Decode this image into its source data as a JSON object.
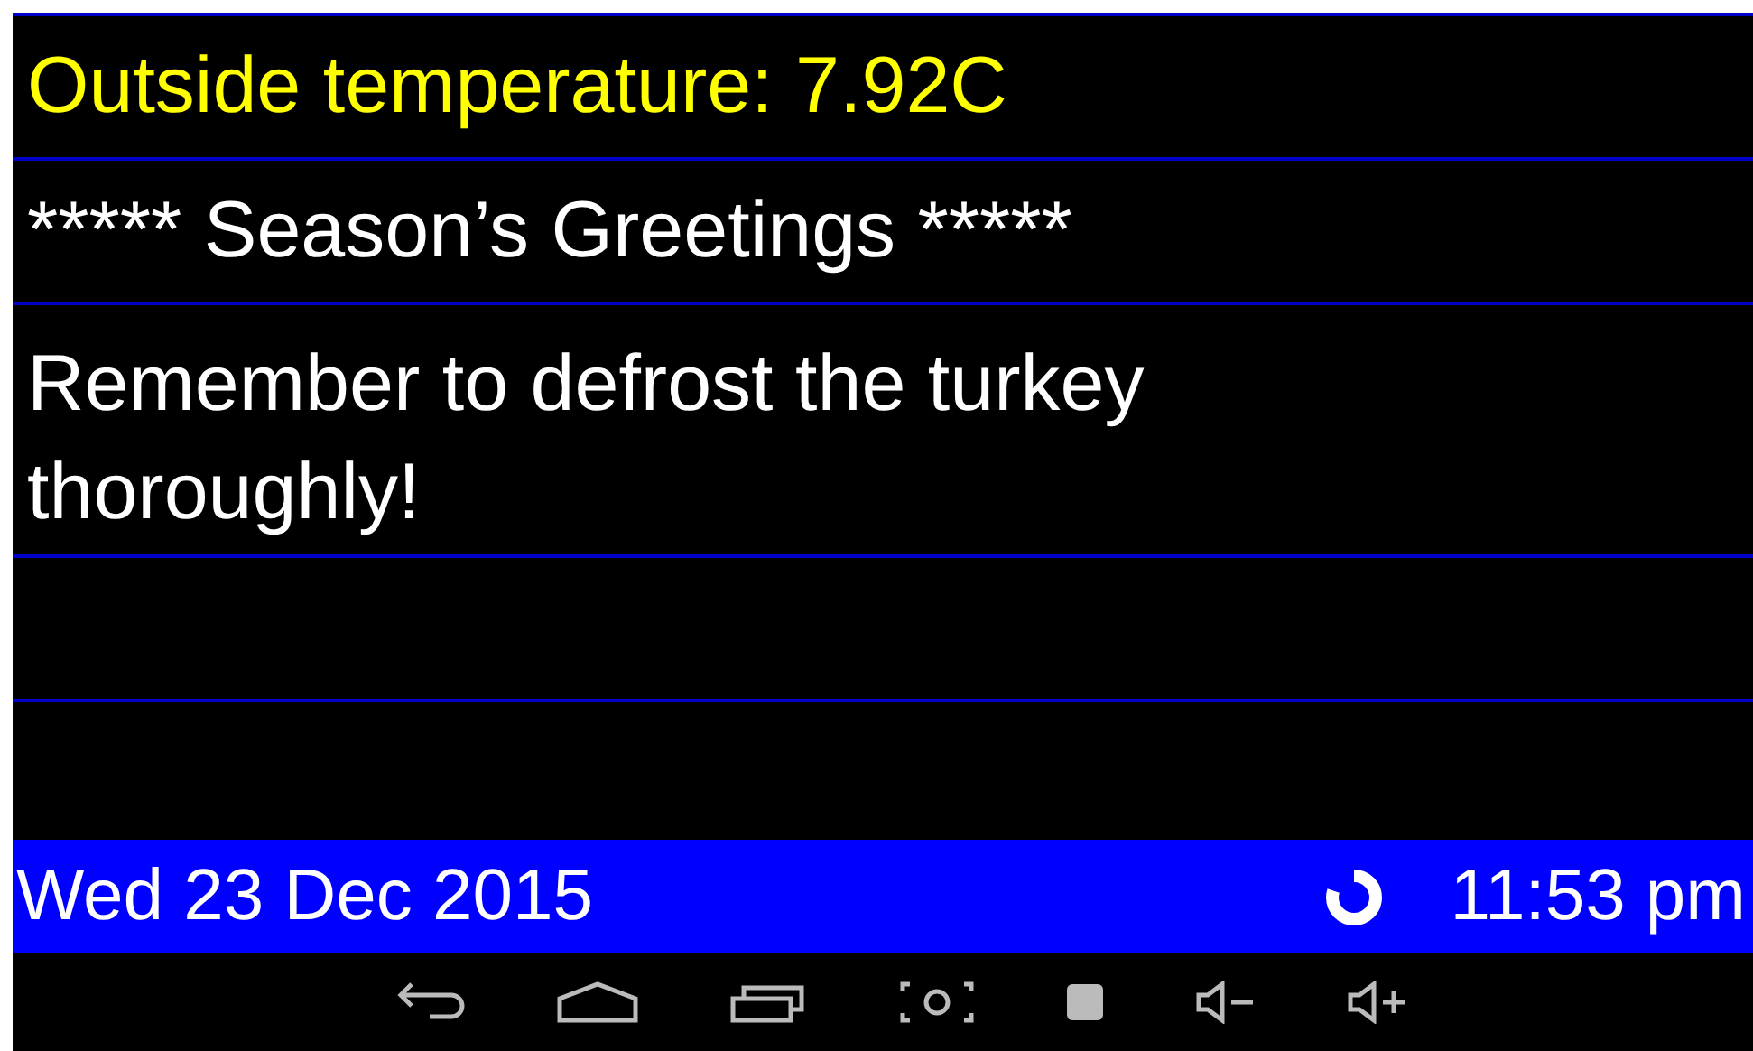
{
  "messages": [
    {
      "text": "Outside temperature: 7.92C",
      "color": "#ffff00"
    },
    {
      "text": "***** Season’s Greetings *****",
      "color": "#ffffff"
    },
    {
      "text": "Remember to defrost the turkey thoroughly!",
      "color": "#ffffff"
    }
  ],
  "status_bar": {
    "date": "Wed 23 Dec 2015",
    "time": "11:53 pm"
  }
}
